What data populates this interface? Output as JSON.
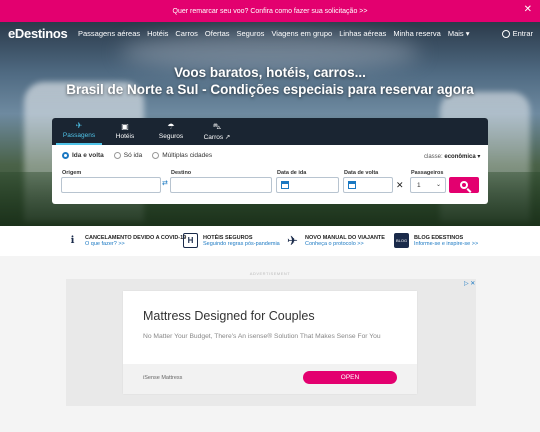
{
  "promo": {
    "text": "Quer remarcar seu voo? Confira como fazer sua solicitação >>",
    "close": "✕"
  },
  "brand": {
    "logo": "eDestinos"
  },
  "nav": {
    "links": [
      "Passagens aéreas",
      "Hotéis",
      "Carros",
      "Ofertas",
      "Seguros",
      "Viagens em grupo",
      "Linhas aéreas",
      "Minha reserva",
      "Mais ▾"
    ],
    "login": "Entrar"
  },
  "hero": {
    "line1": "Voos baratos, hotéis, carros...",
    "line2": "Brasil de Norte a Sul - Condições especiais para reservar agora"
  },
  "search": {
    "tabs": [
      {
        "label": "Passagens",
        "icon": "plane-icon"
      },
      {
        "label": "Hotéis",
        "icon": "hotel-icon"
      },
      {
        "label": "Seguros",
        "icon": "umbrella-icon"
      },
      {
        "label": "Carros ↗",
        "icon": "car-icon"
      }
    ],
    "trip_types": [
      "Ida e volta",
      "Só ida",
      "Múltiplas cidades"
    ],
    "class_label": "classe:",
    "class_value": "econômica ▾",
    "origin_label": "Origem",
    "dest_label": "Destino",
    "depart_label": "Data de ida",
    "return_label": "Data de volta",
    "pax_label": "Passageiros",
    "pax_value": "1",
    "origin_value": "",
    "dest_value": ""
  },
  "info": [
    {
      "title": "CANCELAMENTO DEVIDO A COVID-19",
      "link": "O que fazer? >>",
      "icon": "info-icon"
    },
    {
      "title": "HOTÉIS SEGUROS",
      "link": "Seguindo regras pós-pandemia",
      "icon": "hotel-h-icon"
    },
    {
      "title": "NOVO MANUAL DO VIAJANTE",
      "link": "Conheça o protocolo >>",
      "icon": "plane-icon"
    },
    {
      "title": "BLOG EDESTINOS",
      "link": "Informe-se e inspire-se >>",
      "icon": "blog-icon",
      "badge": "BLOG"
    }
  ],
  "advert": {
    "label": "ADVERTISEMENT",
    "headline": "Mattress Designed for Couples",
    "sub": "No Matter Your Budget, There's An isense® Solution That Makes Sense For You",
    "brand": "iSense Mattress",
    "cta": "OPEN",
    "choices": "▷ ✕"
  },
  "colors": {
    "accent": "#e3006f",
    "tab_bg": "#1a2532",
    "link": "#1a78c2"
  }
}
